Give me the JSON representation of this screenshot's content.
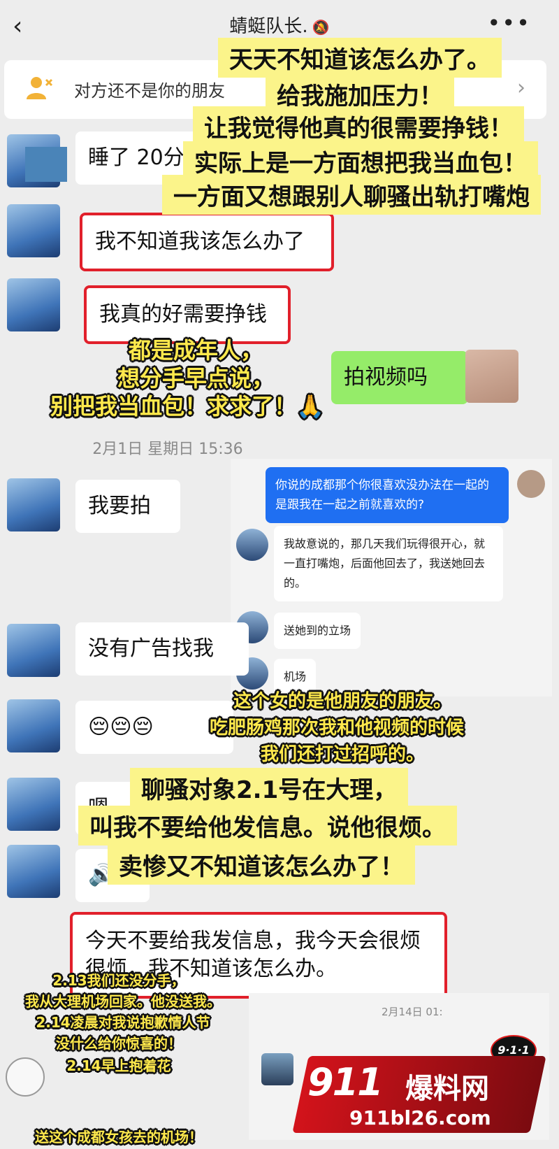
{
  "header": {
    "back_icon": "‹",
    "title": "蜻蜓队长.",
    "mute_icon": "🔕",
    "more_icon": "•••"
  },
  "banner": {
    "text": "对方还不是你的朋友",
    "chevron_icon": "›"
  },
  "messages": {
    "m1": "睡了 20分",
    "m2": "我不知道我该怎么办了",
    "m3": "我真的好需要挣钱",
    "m4": "拍视频吗",
    "m5": "我要拍",
    "m6": "没有广告找我",
    "m7": "😔😔😔",
    "m8": "嗯",
    "m9_icon": "🔊",
    "m10": "今天不要给我发信息，我今天会很烦很烦，我不知道该怎么办。"
  },
  "timestamps": {
    "t1": "2月1日 星期日 15:36",
    "t2": "2月14日 01:"
  },
  "inset": {
    "blue_msg": "你说的成都那个你很喜欢没办法在一起的是跟我在一起之前就喜欢的?",
    "reply1": "我故意说的，那几天我们玩得很开心，就一直打嘴炮，后面他回去了，我送她回去的。",
    "reply2": "送她到的立场",
    "reply3": "机场"
  },
  "captions": {
    "top": [
      "天天不知道该怎么办了。",
      "给我施加压力！",
      "让我觉得他真的很需要挣钱！",
      "实际上是一方面想把我当血包！",
      "一方面又想跟别人聊骚出轨打嘴炮"
    ],
    "middle": [
      "都是成年人，",
      "想分手早点说，",
      "别把我当血包！求求了！🙏"
    ],
    "friend": [
      "这个女的是他朋友的朋友。",
      "吃肥肠鸡那次我和他视频的时候",
      "我们还打过招呼的。"
    ],
    "dali": [
      "聊骚对象2.1号在大理，",
      "叫我不要给他发信息。说他很烦。",
      "卖惨又不知道该怎么办了！"
    ],
    "bottom": [
      "2.13我们还没分手，",
      "我从大理机场回家。他没送我。",
      "2.14凌晨对我说抱歉情人节",
      "没什么给你惊喜的！",
      "2.14早上抱着花",
      "送这个成都女孩去的机场！"
    ]
  },
  "watermark": {
    "badge": "9·1·1",
    "number": "911",
    "name": "爆料网",
    "url": "911bl26.com"
  }
}
